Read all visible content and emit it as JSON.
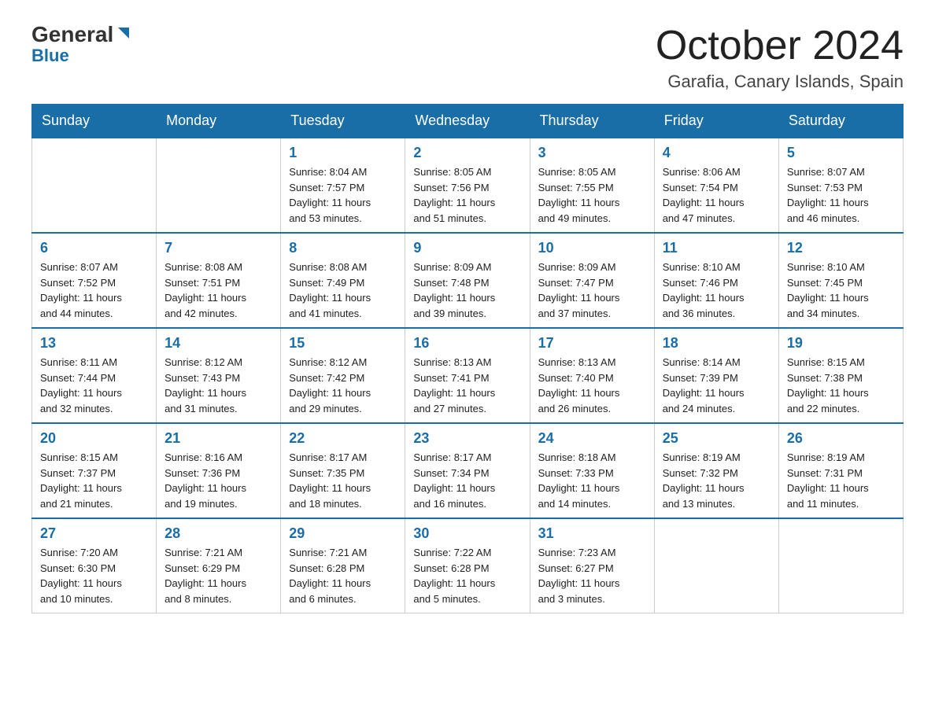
{
  "logo": {
    "general": "General",
    "blue": "Blue"
  },
  "title": "October 2024",
  "location": "Garafia, Canary Islands, Spain",
  "weekdays": [
    "Sunday",
    "Monday",
    "Tuesday",
    "Wednesday",
    "Thursday",
    "Friday",
    "Saturday"
  ],
  "weeks": [
    [
      {
        "day": "",
        "info": ""
      },
      {
        "day": "",
        "info": ""
      },
      {
        "day": "1",
        "info": "Sunrise: 8:04 AM\nSunset: 7:57 PM\nDaylight: 11 hours\nand 53 minutes."
      },
      {
        "day": "2",
        "info": "Sunrise: 8:05 AM\nSunset: 7:56 PM\nDaylight: 11 hours\nand 51 minutes."
      },
      {
        "day": "3",
        "info": "Sunrise: 8:05 AM\nSunset: 7:55 PM\nDaylight: 11 hours\nand 49 minutes."
      },
      {
        "day": "4",
        "info": "Sunrise: 8:06 AM\nSunset: 7:54 PM\nDaylight: 11 hours\nand 47 minutes."
      },
      {
        "day": "5",
        "info": "Sunrise: 8:07 AM\nSunset: 7:53 PM\nDaylight: 11 hours\nand 46 minutes."
      }
    ],
    [
      {
        "day": "6",
        "info": "Sunrise: 8:07 AM\nSunset: 7:52 PM\nDaylight: 11 hours\nand 44 minutes."
      },
      {
        "day": "7",
        "info": "Sunrise: 8:08 AM\nSunset: 7:51 PM\nDaylight: 11 hours\nand 42 minutes."
      },
      {
        "day": "8",
        "info": "Sunrise: 8:08 AM\nSunset: 7:49 PM\nDaylight: 11 hours\nand 41 minutes."
      },
      {
        "day": "9",
        "info": "Sunrise: 8:09 AM\nSunset: 7:48 PM\nDaylight: 11 hours\nand 39 minutes."
      },
      {
        "day": "10",
        "info": "Sunrise: 8:09 AM\nSunset: 7:47 PM\nDaylight: 11 hours\nand 37 minutes."
      },
      {
        "day": "11",
        "info": "Sunrise: 8:10 AM\nSunset: 7:46 PM\nDaylight: 11 hours\nand 36 minutes."
      },
      {
        "day": "12",
        "info": "Sunrise: 8:10 AM\nSunset: 7:45 PM\nDaylight: 11 hours\nand 34 minutes."
      }
    ],
    [
      {
        "day": "13",
        "info": "Sunrise: 8:11 AM\nSunset: 7:44 PM\nDaylight: 11 hours\nand 32 minutes."
      },
      {
        "day": "14",
        "info": "Sunrise: 8:12 AM\nSunset: 7:43 PM\nDaylight: 11 hours\nand 31 minutes."
      },
      {
        "day": "15",
        "info": "Sunrise: 8:12 AM\nSunset: 7:42 PM\nDaylight: 11 hours\nand 29 minutes."
      },
      {
        "day": "16",
        "info": "Sunrise: 8:13 AM\nSunset: 7:41 PM\nDaylight: 11 hours\nand 27 minutes."
      },
      {
        "day": "17",
        "info": "Sunrise: 8:13 AM\nSunset: 7:40 PM\nDaylight: 11 hours\nand 26 minutes."
      },
      {
        "day": "18",
        "info": "Sunrise: 8:14 AM\nSunset: 7:39 PM\nDaylight: 11 hours\nand 24 minutes."
      },
      {
        "day": "19",
        "info": "Sunrise: 8:15 AM\nSunset: 7:38 PM\nDaylight: 11 hours\nand 22 minutes."
      }
    ],
    [
      {
        "day": "20",
        "info": "Sunrise: 8:15 AM\nSunset: 7:37 PM\nDaylight: 11 hours\nand 21 minutes."
      },
      {
        "day": "21",
        "info": "Sunrise: 8:16 AM\nSunset: 7:36 PM\nDaylight: 11 hours\nand 19 minutes."
      },
      {
        "day": "22",
        "info": "Sunrise: 8:17 AM\nSunset: 7:35 PM\nDaylight: 11 hours\nand 18 minutes."
      },
      {
        "day": "23",
        "info": "Sunrise: 8:17 AM\nSunset: 7:34 PM\nDaylight: 11 hours\nand 16 minutes."
      },
      {
        "day": "24",
        "info": "Sunrise: 8:18 AM\nSunset: 7:33 PM\nDaylight: 11 hours\nand 14 minutes."
      },
      {
        "day": "25",
        "info": "Sunrise: 8:19 AM\nSunset: 7:32 PM\nDaylight: 11 hours\nand 13 minutes."
      },
      {
        "day": "26",
        "info": "Sunrise: 8:19 AM\nSunset: 7:31 PM\nDaylight: 11 hours\nand 11 minutes."
      }
    ],
    [
      {
        "day": "27",
        "info": "Sunrise: 7:20 AM\nSunset: 6:30 PM\nDaylight: 11 hours\nand 10 minutes."
      },
      {
        "day": "28",
        "info": "Sunrise: 7:21 AM\nSunset: 6:29 PM\nDaylight: 11 hours\nand 8 minutes."
      },
      {
        "day": "29",
        "info": "Sunrise: 7:21 AM\nSunset: 6:28 PM\nDaylight: 11 hours\nand 6 minutes."
      },
      {
        "day": "30",
        "info": "Sunrise: 7:22 AM\nSunset: 6:28 PM\nDaylight: 11 hours\nand 5 minutes."
      },
      {
        "day": "31",
        "info": "Sunrise: 7:23 AM\nSunset: 6:27 PM\nDaylight: 11 hours\nand 3 minutes."
      },
      {
        "day": "",
        "info": ""
      },
      {
        "day": "",
        "info": ""
      }
    ]
  ]
}
